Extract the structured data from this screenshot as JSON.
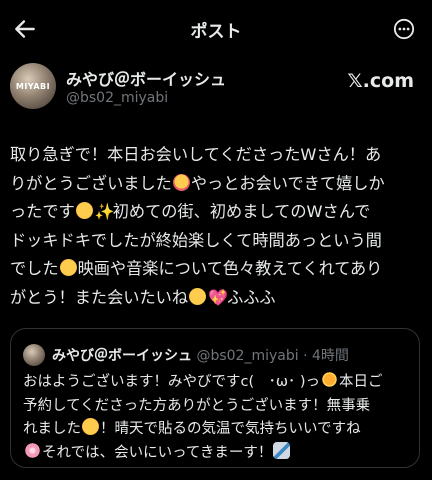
{
  "header": {
    "title": "ポスト"
  },
  "author": {
    "display_name": "みやび＠ボーイッシュ",
    "handle": "@bs02_miyabi",
    "avatar_text": "MIYABI",
    "source_label": "𝕏.com"
  },
  "tweet": {
    "lines": [
      "取り急ぎで！本日お会いしてくださったWさん！あ",
      "りがとうございました",
      "やっとお会いできて嬉しか",
      "ったです",
      "初めての街、初めましてのWさんで",
      "ドッキドキでしたが終始楽しくて時間あっという間",
      "でした",
      "映画や音楽について色々教えてくれてあり",
      "がとう！また会いたいね",
      "ふふふ"
    ]
  },
  "quote": {
    "name": "みやび＠ボーイッシュ",
    "handle": "@bs02_miyabi",
    "separator": "·",
    "time": "4時間",
    "lines": [
      "おはようございます！みやびですc(　･ω･ )っ",
      "本日ご",
      "予約してくださった方ありがとうございます！無事乗",
      "れました",
      "！晴天で貼るの気温で気持ちいいですね",
      "それでは、会いにいってきまーす！"
    ]
  },
  "colors": {
    "background": "#000000",
    "text": "#e7e9ea",
    "secondary_text": "#71767b",
    "border": "#2f3336"
  },
  "icons": {
    "back": "arrow-left-icon",
    "more": "more-horizontal-icon"
  }
}
